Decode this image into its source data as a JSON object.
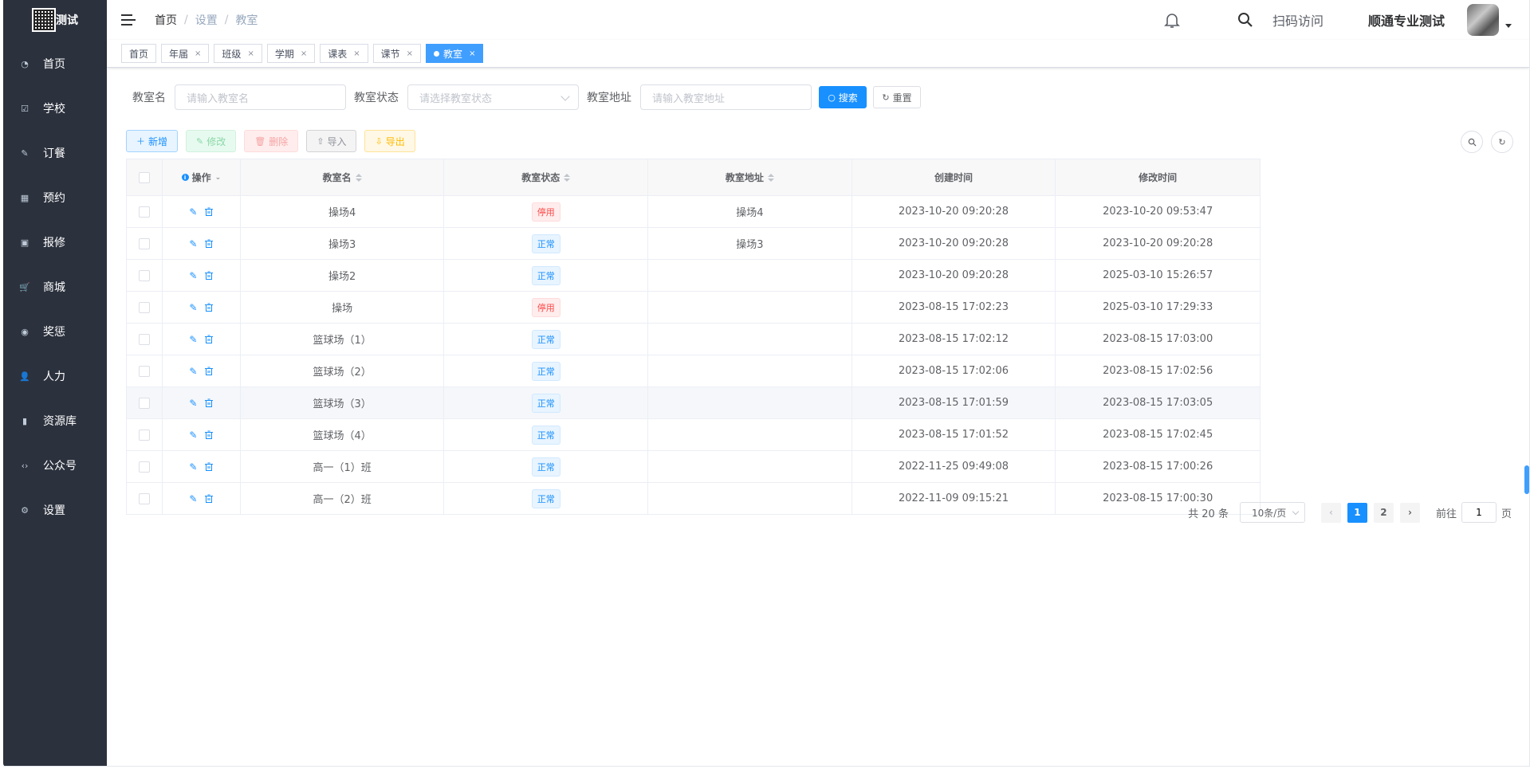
{
  "app": {
    "logo_text": "测试"
  },
  "sidebar": {
    "items": [
      {
        "label": "首页",
        "icon": "dashboard-icon"
      },
      {
        "label": "学校",
        "icon": "checkbox-icon"
      },
      {
        "label": "订餐",
        "icon": "edit-icon"
      },
      {
        "label": "预约",
        "icon": "calendar-icon"
      },
      {
        "label": "报修",
        "icon": "toolbox-icon"
      },
      {
        "label": "商城",
        "icon": "cart-icon"
      },
      {
        "label": "奖惩",
        "icon": "eye-icon"
      },
      {
        "label": "人力",
        "icon": "user-icon"
      },
      {
        "label": "资源库",
        "icon": "bar-chart-icon"
      },
      {
        "label": "公众号",
        "icon": "code-icon"
      },
      {
        "label": "设置",
        "icon": "settings-icon"
      }
    ]
  },
  "header": {
    "breadcrumb": [
      "首页",
      "设置",
      "教室"
    ],
    "breadcrumb_sep": "/",
    "scan_label": "扫码访问",
    "username": "顺通专业测试"
  },
  "tags": [
    {
      "label": "首页",
      "closable": false,
      "active": false
    },
    {
      "label": "年届",
      "closable": true,
      "active": false
    },
    {
      "label": "班级",
      "closable": true,
      "active": false
    },
    {
      "label": "学期",
      "closable": true,
      "active": false
    },
    {
      "label": "课表",
      "closable": true,
      "active": false
    },
    {
      "label": "课节",
      "closable": true,
      "active": false
    },
    {
      "label": "教室",
      "closable": true,
      "active": true
    }
  ],
  "filters": {
    "name_label": "教室名",
    "name_placeholder": "请输入教室名",
    "status_label": "教室状态",
    "status_placeholder": "请选择教室状态",
    "addr_label": "教室地址",
    "addr_placeholder": "请输入教室地址",
    "search_btn": "搜索",
    "reset_btn": "重置"
  },
  "toolbar": {
    "add": "新增",
    "edit": "修改",
    "delete": "删除",
    "import": "导入",
    "export": "导出"
  },
  "table": {
    "headers": {
      "op": "操作",
      "name": "教室名",
      "status": "教室状态",
      "addr": "教室地址",
      "created": "创建时间",
      "modified": "修改时间"
    },
    "rows": [
      {
        "name": "操场4",
        "status": "停用",
        "addr": "操场4",
        "created": "2023-10-20 09:20:28",
        "modified": "2023-10-20 09:53:47"
      },
      {
        "name": "操场3",
        "status": "正常",
        "addr": "操场3",
        "created": "2023-10-20 09:20:28",
        "modified": "2023-10-20 09:20:28"
      },
      {
        "name": "操场2",
        "status": "正常",
        "addr": "",
        "created": "2023-10-20 09:20:28",
        "modified": "2025-03-10 15:26:57"
      },
      {
        "name": "操场",
        "status": "停用",
        "addr": "",
        "created": "2023-08-15 17:02:23",
        "modified": "2025-03-10 17:29:33"
      },
      {
        "name": "篮球场（1）",
        "status": "正常",
        "addr": "",
        "created": "2023-08-15 17:02:12",
        "modified": "2023-08-15 17:03:00"
      },
      {
        "name": "篮球场（2）",
        "status": "正常",
        "addr": "",
        "created": "2023-08-15 17:02:06",
        "modified": "2023-08-15 17:02:56"
      },
      {
        "name": "篮球场（3）",
        "status": "正常",
        "addr": "",
        "created": "2023-08-15 17:01:59",
        "modified": "2023-08-15 17:03:05"
      },
      {
        "name": "篮球场（4）",
        "status": "正常",
        "addr": "",
        "created": "2023-08-15 17:01:52",
        "modified": "2023-08-15 17:02:45"
      },
      {
        "name": "高一（1）班",
        "status": "正常",
        "addr": "",
        "created": "2022-11-25 09:49:08",
        "modified": "2023-08-15 17:00:26"
      },
      {
        "name": "高一（2）班",
        "status": "正常",
        "addr": "",
        "created": "2022-11-09 09:15:21",
        "modified": "2023-08-15 17:00:30"
      }
    ]
  },
  "pagination": {
    "total_label": "共 20 条",
    "page_size": "10条/页",
    "pages": [
      "1",
      "2"
    ],
    "current": "1",
    "goto_prefix": "前往",
    "goto_value": "1",
    "goto_suffix": "页"
  },
  "colors": {
    "sidebar_bg": "#2b313d",
    "primary": "#1890ff",
    "danger": "#ff4949"
  }
}
